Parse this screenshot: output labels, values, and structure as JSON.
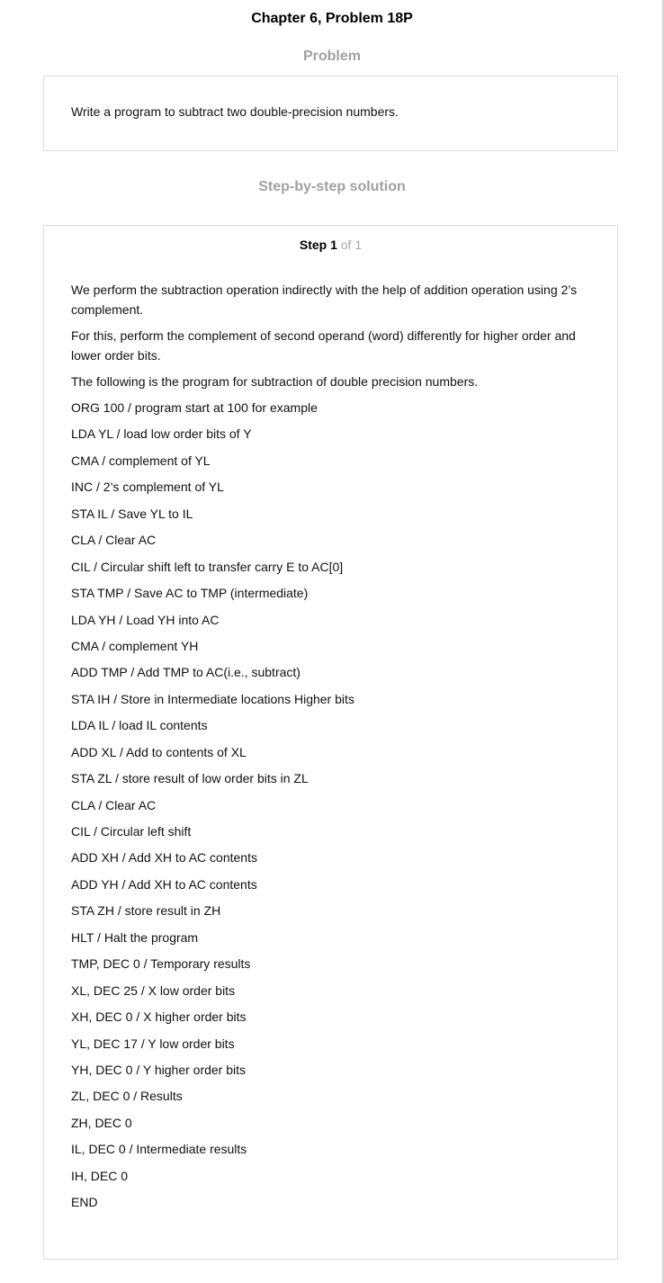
{
  "page": {
    "title": "Chapter 6, Problem 18P"
  },
  "problem": {
    "heading": "Problem",
    "text": "Write a program to subtract two double-precision numbers."
  },
  "solution": {
    "heading": "Step-by-step solution",
    "step": {
      "label": "Step 1",
      "of": "of 1",
      "paragraphs": [
        "We perform the subtraction operation indirectly with the help of addition operation using 2’s complement.",
        "For this, perform the complement of second operand (word) differently for higher order and lower order bits.",
        "The following is the program for subtraction of double precision numbers."
      ],
      "code_lines": [
        "ORG 100 / program start at 100 for example",
        "LDA YL / load low order bits of Y",
        "CMA / complement of YL",
        "INC / 2’s complement of YL",
        "STA IL / Save YL to IL",
        "CLA / Clear AC",
        "CIL / Circular shift left to transfer carry E to AC[0]",
        "STA TMP / Save AC to TMP (intermediate)",
        "LDA YH / Load YH into AC",
        "CMA / complement YH",
        "ADD TMP / Add TMP to AC(i.e., subtract)",
        "STA IH / Store in Intermediate locations Higher bits",
        "LDA IL / load IL contents",
        "ADD XL / Add to contents of XL",
        "STA ZL / store result of low order bits in ZL",
        "CLA / Clear AC",
        "CIL / Circular left shift",
        "ADD XH / Add XH to AC contents",
        "ADD YH / Add XH to AC contents",
        "STA ZH / store result in ZH",
        "HLT / Halt the program",
        "TMP, DEC 0 / Temporary results",
        "XL, DEC 25 / X low order bits",
        "XH, DEC 0 / X higher order bits",
        "YL, DEC 17 / Y low order bits",
        "YH, DEC 0 / Y higher order bits",
        "ZL, DEC 0 / Results",
        "ZH, DEC 0",
        "IL, DEC 0 / Intermediate results",
        "IH, DEC 0",
        "END"
      ]
    }
  }
}
